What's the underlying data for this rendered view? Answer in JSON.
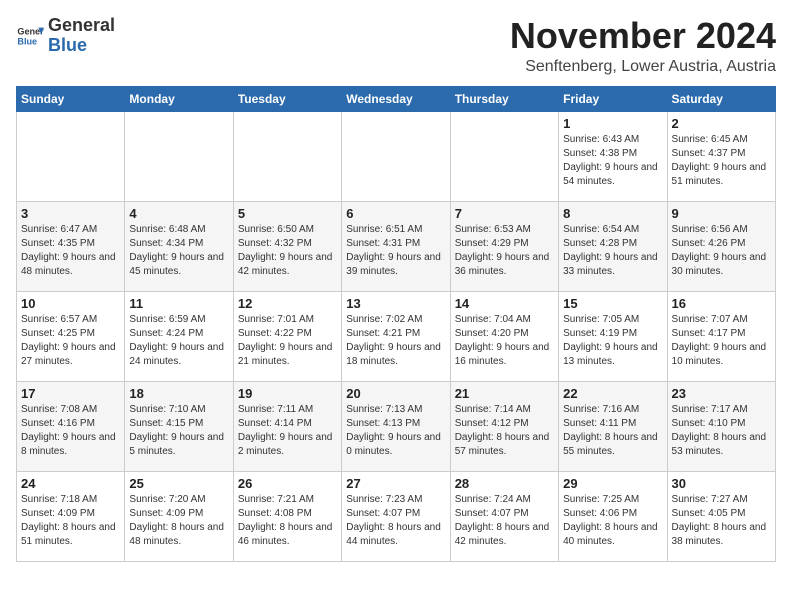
{
  "logo": {
    "text_general": "General",
    "text_blue": "Blue"
  },
  "title": {
    "month": "November 2024",
    "location": "Senftenberg, Lower Austria, Austria"
  },
  "weekdays": [
    "Sunday",
    "Monday",
    "Tuesday",
    "Wednesday",
    "Thursday",
    "Friday",
    "Saturday"
  ],
  "weeks": [
    [
      {
        "day": "",
        "info": ""
      },
      {
        "day": "",
        "info": ""
      },
      {
        "day": "",
        "info": ""
      },
      {
        "day": "",
        "info": ""
      },
      {
        "day": "",
        "info": ""
      },
      {
        "day": "1",
        "info": "Sunrise: 6:43 AM\nSunset: 4:38 PM\nDaylight: 9 hours and 54 minutes."
      },
      {
        "day": "2",
        "info": "Sunrise: 6:45 AM\nSunset: 4:37 PM\nDaylight: 9 hours and 51 minutes."
      }
    ],
    [
      {
        "day": "3",
        "info": "Sunrise: 6:47 AM\nSunset: 4:35 PM\nDaylight: 9 hours and 48 minutes."
      },
      {
        "day": "4",
        "info": "Sunrise: 6:48 AM\nSunset: 4:34 PM\nDaylight: 9 hours and 45 minutes."
      },
      {
        "day": "5",
        "info": "Sunrise: 6:50 AM\nSunset: 4:32 PM\nDaylight: 9 hours and 42 minutes."
      },
      {
        "day": "6",
        "info": "Sunrise: 6:51 AM\nSunset: 4:31 PM\nDaylight: 9 hours and 39 minutes."
      },
      {
        "day": "7",
        "info": "Sunrise: 6:53 AM\nSunset: 4:29 PM\nDaylight: 9 hours and 36 minutes."
      },
      {
        "day": "8",
        "info": "Sunrise: 6:54 AM\nSunset: 4:28 PM\nDaylight: 9 hours and 33 minutes."
      },
      {
        "day": "9",
        "info": "Sunrise: 6:56 AM\nSunset: 4:26 PM\nDaylight: 9 hours and 30 minutes."
      }
    ],
    [
      {
        "day": "10",
        "info": "Sunrise: 6:57 AM\nSunset: 4:25 PM\nDaylight: 9 hours and 27 minutes."
      },
      {
        "day": "11",
        "info": "Sunrise: 6:59 AM\nSunset: 4:24 PM\nDaylight: 9 hours and 24 minutes."
      },
      {
        "day": "12",
        "info": "Sunrise: 7:01 AM\nSunset: 4:22 PM\nDaylight: 9 hours and 21 minutes."
      },
      {
        "day": "13",
        "info": "Sunrise: 7:02 AM\nSunset: 4:21 PM\nDaylight: 9 hours and 18 minutes."
      },
      {
        "day": "14",
        "info": "Sunrise: 7:04 AM\nSunset: 4:20 PM\nDaylight: 9 hours and 16 minutes."
      },
      {
        "day": "15",
        "info": "Sunrise: 7:05 AM\nSunset: 4:19 PM\nDaylight: 9 hours and 13 minutes."
      },
      {
        "day": "16",
        "info": "Sunrise: 7:07 AM\nSunset: 4:17 PM\nDaylight: 9 hours and 10 minutes."
      }
    ],
    [
      {
        "day": "17",
        "info": "Sunrise: 7:08 AM\nSunset: 4:16 PM\nDaylight: 9 hours and 8 minutes."
      },
      {
        "day": "18",
        "info": "Sunrise: 7:10 AM\nSunset: 4:15 PM\nDaylight: 9 hours and 5 minutes."
      },
      {
        "day": "19",
        "info": "Sunrise: 7:11 AM\nSunset: 4:14 PM\nDaylight: 9 hours and 2 minutes."
      },
      {
        "day": "20",
        "info": "Sunrise: 7:13 AM\nSunset: 4:13 PM\nDaylight: 9 hours and 0 minutes."
      },
      {
        "day": "21",
        "info": "Sunrise: 7:14 AM\nSunset: 4:12 PM\nDaylight: 8 hours and 57 minutes."
      },
      {
        "day": "22",
        "info": "Sunrise: 7:16 AM\nSunset: 4:11 PM\nDaylight: 8 hours and 55 minutes."
      },
      {
        "day": "23",
        "info": "Sunrise: 7:17 AM\nSunset: 4:10 PM\nDaylight: 8 hours and 53 minutes."
      }
    ],
    [
      {
        "day": "24",
        "info": "Sunrise: 7:18 AM\nSunset: 4:09 PM\nDaylight: 8 hours and 51 minutes."
      },
      {
        "day": "25",
        "info": "Sunrise: 7:20 AM\nSunset: 4:09 PM\nDaylight: 8 hours and 48 minutes."
      },
      {
        "day": "26",
        "info": "Sunrise: 7:21 AM\nSunset: 4:08 PM\nDaylight: 8 hours and 46 minutes."
      },
      {
        "day": "27",
        "info": "Sunrise: 7:23 AM\nSunset: 4:07 PM\nDaylight: 8 hours and 44 minutes."
      },
      {
        "day": "28",
        "info": "Sunrise: 7:24 AM\nSunset: 4:07 PM\nDaylight: 8 hours and 42 minutes."
      },
      {
        "day": "29",
        "info": "Sunrise: 7:25 AM\nSunset: 4:06 PM\nDaylight: 8 hours and 40 minutes."
      },
      {
        "day": "30",
        "info": "Sunrise: 7:27 AM\nSunset: 4:05 PM\nDaylight: 8 hours and 38 minutes."
      }
    ]
  ]
}
